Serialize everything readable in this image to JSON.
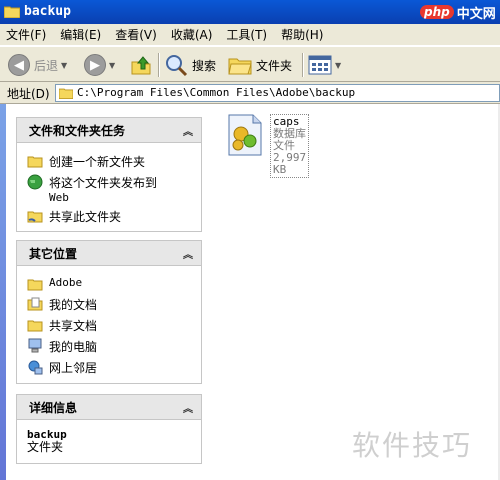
{
  "window": {
    "title": "backup",
    "brand_php": "php",
    "brand_cn": "中文网"
  },
  "menu": [
    "文件(F)",
    "编辑(E)",
    "查看(V)",
    "收藏(A)",
    "工具(T)",
    "帮助(H)"
  ],
  "toolbar": {
    "back": "后退",
    "search": "搜索",
    "folders": "文件夹"
  },
  "address": {
    "label": "地址(D)",
    "path": "C:\\Program Files\\Common Files\\Adobe\\backup"
  },
  "tasks_panel": {
    "title": "文件和文件夹任务",
    "items": [
      "创建一个新文件夹",
      "将这个文件夹发布到",
      "Web",
      "共享此文件夹"
    ]
  },
  "places_panel": {
    "title": "其它位置",
    "items": [
      "Adobe",
      "我的文档",
      "共享文档",
      "我的电脑",
      "网上邻居"
    ]
  },
  "details_panel": {
    "title": "详细信息",
    "name": "backup",
    "type": "文件夹"
  },
  "file": {
    "name": "caps",
    "type": "数据库文件",
    "size": "2,997 KB"
  },
  "watermark": "软件技巧"
}
